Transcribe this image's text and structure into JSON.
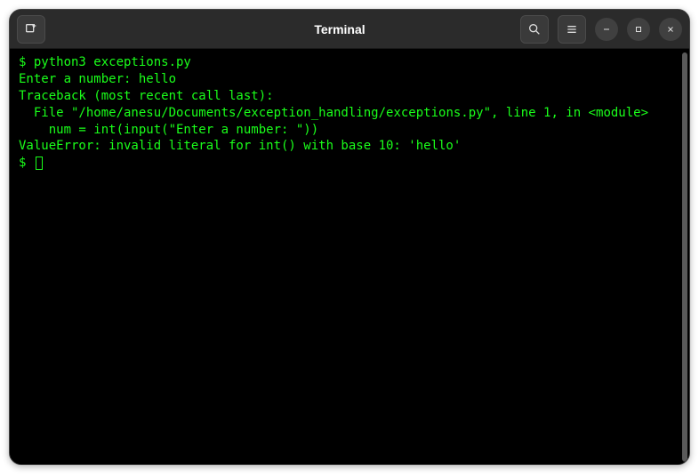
{
  "window": {
    "title": "Terminal"
  },
  "terminal": {
    "lines": {
      "l0": "$ python3 exceptions.py",
      "l1": "Enter a number: hello",
      "l2": "Traceback (most recent call last):",
      "l3": "  File \"/home/anesu/Documents/exception_handling/exceptions.py\", line 1, in <module>",
      "l4": "    num = int(input(\"Enter a number: \"))",
      "l5": "ValueError: invalid literal for int() with base 10: 'hello'",
      "prompt": "$ "
    }
  }
}
